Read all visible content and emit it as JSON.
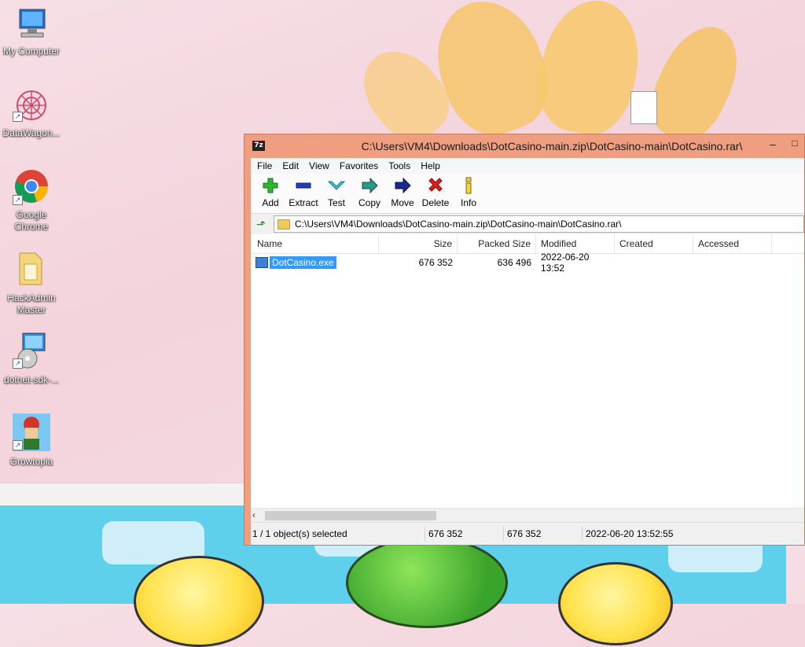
{
  "desktop": {
    "icons": [
      {
        "label": "My Computer"
      },
      {
        "label": "DataWagon..."
      },
      {
        "label": "Google Chrome"
      },
      {
        "label": "HackAdmin Master"
      },
      {
        "label": "dotnet-sdk-..."
      },
      {
        "label": "Growtopia"
      }
    ]
  },
  "window": {
    "title": "C:\\Users\\VM4\\Downloads\\DotCasino-main.zip\\DotCasino-main\\DotCasino.rar\\",
    "app_badge": "7z",
    "controls": {
      "minimize": "–",
      "maximize": "□"
    },
    "menu": [
      "File",
      "Edit",
      "View",
      "Favorites",
      "Tools",
      "Help"
    ],
    "toolbar": [
      {
        "label": "Add",
        "icon": "add-icon"
      },
      {
        "label": "Extract",
        "icon": "extract-icon"
      },
      {
        "label": "Test",
        "icon": "test-icon"
      },
      {
        "label": "Copy",
        "icon": "copy-icon"
      },
      {
        "label": "Move",
        "icon": "move-icon"
      },
      {
        "label": "Delete",
        "icon": "delete-icon"
      },
      {
        "label": "Info",
        "icon": "info-icon"
      }
    ],
    "address": "C:\\Users\\VM4\\Downloads\\DotCasino-main.zip\\DotCasino-main\\DotCasino.rar\\",
    "columns": [
      "Name",
      "Size",
      "Packed Size",
      "Modified",
      "Created",
      "Accessed"
    ],
    "rows": [
      {
        "name": "DotCasino.exe",
        "size": "676 352",
        "packed": "636 496",
        "modified": "2022-06-20 13:52",
        "created": "",
        "accessed": ""
      }
    ],
    "status": {
      "selected": "1 / 1 object(s) selected",
      "size": "676 352",
      "total": "676 352",
      "modified": "2022-06-20 13:52:55"
    }
  },
  "colors": {
    "accent": "#3399ff",
    "window_border": "#ef9f7f"
  }
}
